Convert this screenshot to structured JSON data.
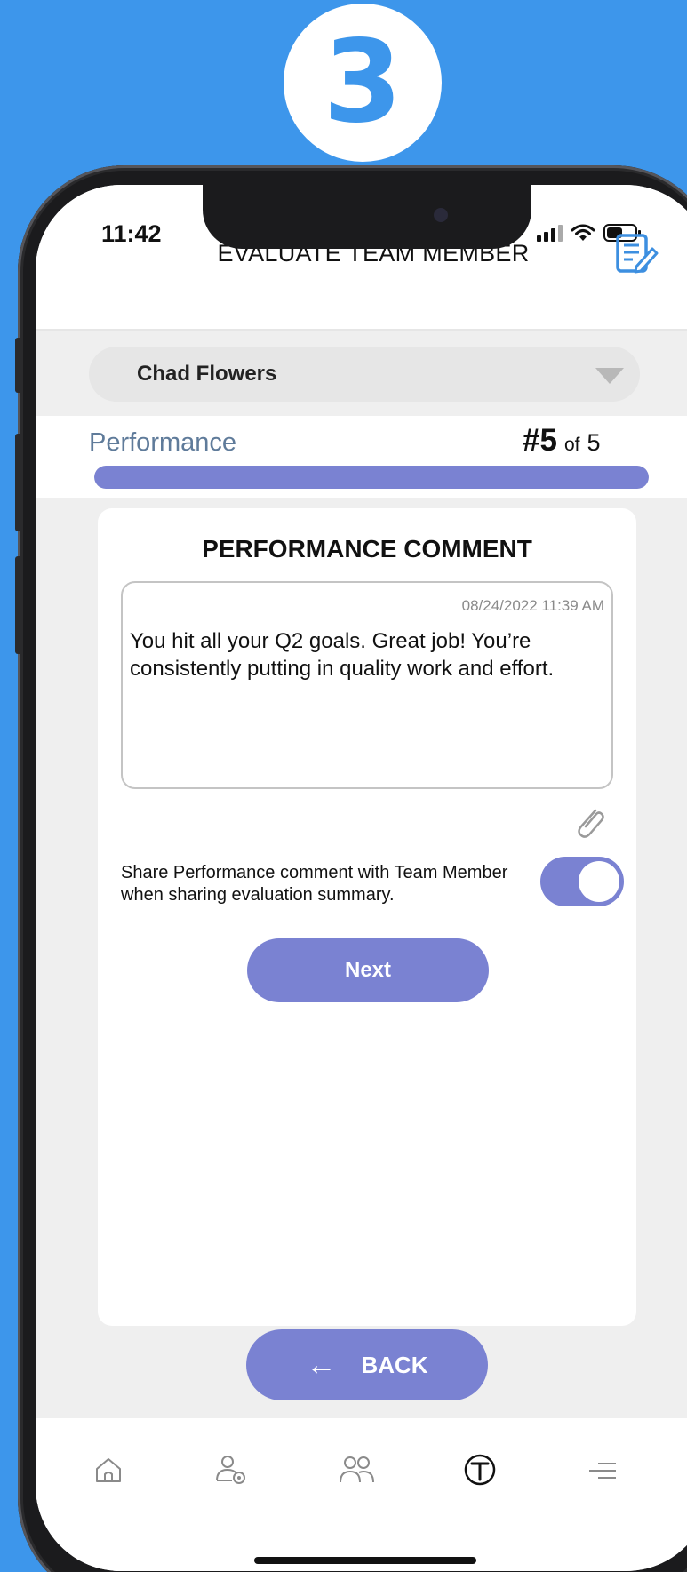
{
  "step_badge": "3",
  "status_bar": {
    "time": "11:42"
  },
  "header": {
    "title": "EVALUATE TEAM MEMBER",
    "edit_icon": "edit-document-icon"
  },
  "member_select": {
    "value": "Chad Flowers"
  },
  "progress": {
    "category": "Performance",
    "current": "#5",
    "of_label": "of",
    "total": "5",
    "fraction": 1.0
  },
  "comment": {
    "title": "PERFORMANCE COMMENT",
    "date": "08/24/2022 11:39 AM",
    "text": "You hit all your Q2 goals. Great job! You’re consistently putting in quality work and effort."
  },
  "share": {
    "label": "Share Performance comment with Team Member when sharing evaluation summary.",
    "enabled": true
  },
  "buttons": {
    "next": "Next",
    "back": "BACK"
  },
  "tabbar": {
    "items": [
      "home-icon",
      "person-badge-icon",
      "team-icon",
      "t-logo-icon",
      "menu-icon"
    ]
  },
  "colors": {
    "background": "#3d96eb",
    "accent": "#7a82d2",
    "category": "#5f7b9a"
  }
}
